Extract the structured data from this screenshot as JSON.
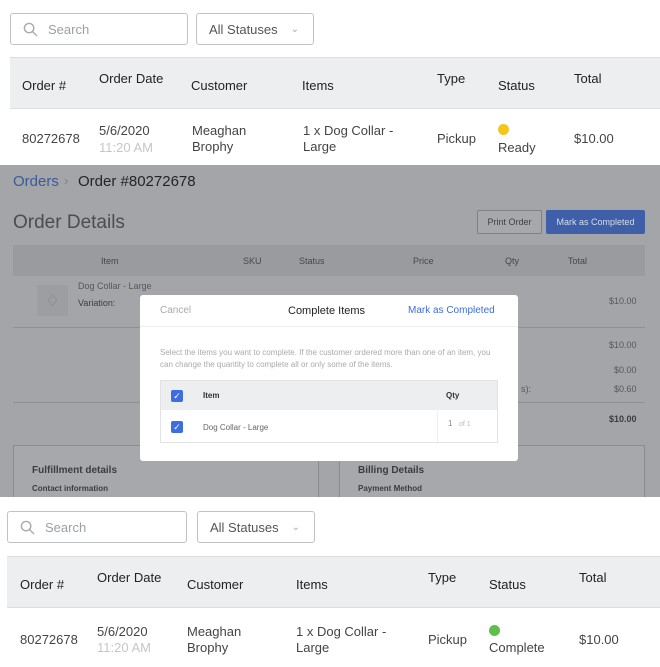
{
  "before": {
    "search_placeholder": "Search",
    "status_filter": "All Statuses",
    "columns": [
      "Order #",
      "Order Date",
      "Customer",
      "Items",
      "Type",
      "Status",
      "Total"
    ],
    "row": {
      "order": "80272678",
      "date": "5/6/2020",
      "time": "11:20 AM",
      "customer_first": "Meaghan",
      "customer_last": "Brophy",
      "items_1": "1 x Dog Collar -",
      "items_2": "Large",
      "type": "Pickup",
      "status": "Ready",
      "status_color": "#f5c518",
      "total": "$10.00"
    }
  },
  "detail": {
    "breadcrumb_parent": "Orders",
    "breadcrumb_current": "Order #80272678",
    "title": "Order Details",
    "print_label": "Print Order",
    "complete_label": "Mark as Completed",
    "columns": [
      "Item",
      "SKU",
      "Status",
      "Price",
      "Qty",
      "Total"
    ],
    "item_name": "Dog Collar - Large",
    "item_variation": "Variation:",
    "item_total": "$10.00",
    "subtotal": "$10.00",
    "line2": "$0.00",
    "tax_label": "s):",
    "tax": "$0.60",
    "grand_total": "$10.00",
    "fulfillment_title": "Fulfillment details",
    "contact_label": "Contact information",
    "billing_title": "Billing Details",
    "payment_label": "Payment Method"
  },
  "modal": {
    "cancel": "Cancel",
    "title": "Complete Items",
    "confirm": "Mark as Completed",
    "instructions": "Select the items you want to complete. If the customer ordered more than one of an item, you can change the quantity to complete all or only some of the items.",
    "col_item": "Item",
    "col_qty": "Qty",
    "item": "Dog Collar - Large",
    "qty": "1",
    "qty_of": "of 1"
  },
  "after": {
    "search_placeholder": "Search",
    "status_filter": "All Statuses",
    "columns": [
      "Order #",
      "Order Date",
      "Customer",
      "Items",
      "Type",
      "Status",
      "Total"
    ],
    "row": {
      "order": "80272678",
      "date": "5/6/2020",
      "time": "11:20 AM",
      "customer_first": "Meaghan",
      "customer_last": "Brophy",
      "items_1": "1 x Dog Collar -",
      "items_2": "Large",
      "type": "Pickup",
      "status": "Complete",
      "status_color": "#5cc04a",
      "total": "$10.00"
    }
  }
}
